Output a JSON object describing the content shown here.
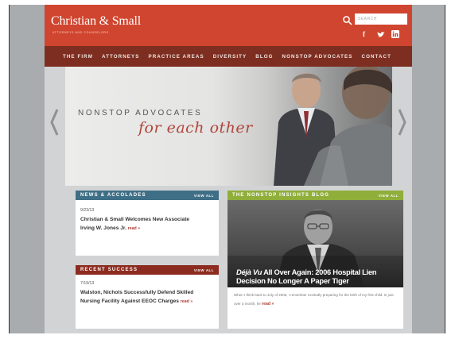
{
  "brand": {
    "name": "Christian & Small",
    "tagline": "ATTORNEYS AND COUNSELORS"
  },
  "search": {
    "placeholder": "SEARCH"
  },
  "social": {
    "facebook": "f",
    "twitter": "t",
    "linkedin": "in"
  },
  "nav": {
    "items": [
      "THE FIRM",
      "ATTORNEYS",
      "PRACTICE AREAS",
      "DIVERSITY",
      "BLOG",
      "NONSTOP ADVOCATES",
      "CONTACT"
    ]
  },
  "hero": {
    "title": "NONSTOP ADVOCATES",
    "script": "for each other"
  },
  "news": {
    "heading": "NEWS & ACCOLADES",
    "view_all": "VIEW ALL",
    "date": "9/23/13",
    "line1": "Christian & Small Welcomes New Associate",
    "line2": "Irving W. Jones Jr.",
    "read": "read »"
  },
  "success": {
    "heading": "RECENT SUCCESS",
    "view_all": "VIEW ALL",
    "date": "7/19/13",
    "line1": "Walston, Nichols Successfully Defend Skilled",
    "line2": "Nursing Facility Against EEOC Charges",
    "read": "read »"
  },
  "blog": {
    "heading": "THE NONSTOP INSIGHTS BLOG",
    "view_all": "VIEW ALL",
    "headline_em": "Déjà Vu",
    "headline_rest": " All Over Again: 2006 Hospital Lien Decision No Longer A Paper Tiger",
    "excerpt": "When I think back to July of 2006, I remember excitedly preparing for the birth of my first child. In just over a month, he",
    "read": "read »"
  },
  "colors": {
    "header_red": "#d0452f",
    "nav_dark_red": "#7d2e20",
    "news_blue": "#3f6f86",
    "success_red": "#8c2c20",
    "blog_green": "#8fae3a"
  }
}
